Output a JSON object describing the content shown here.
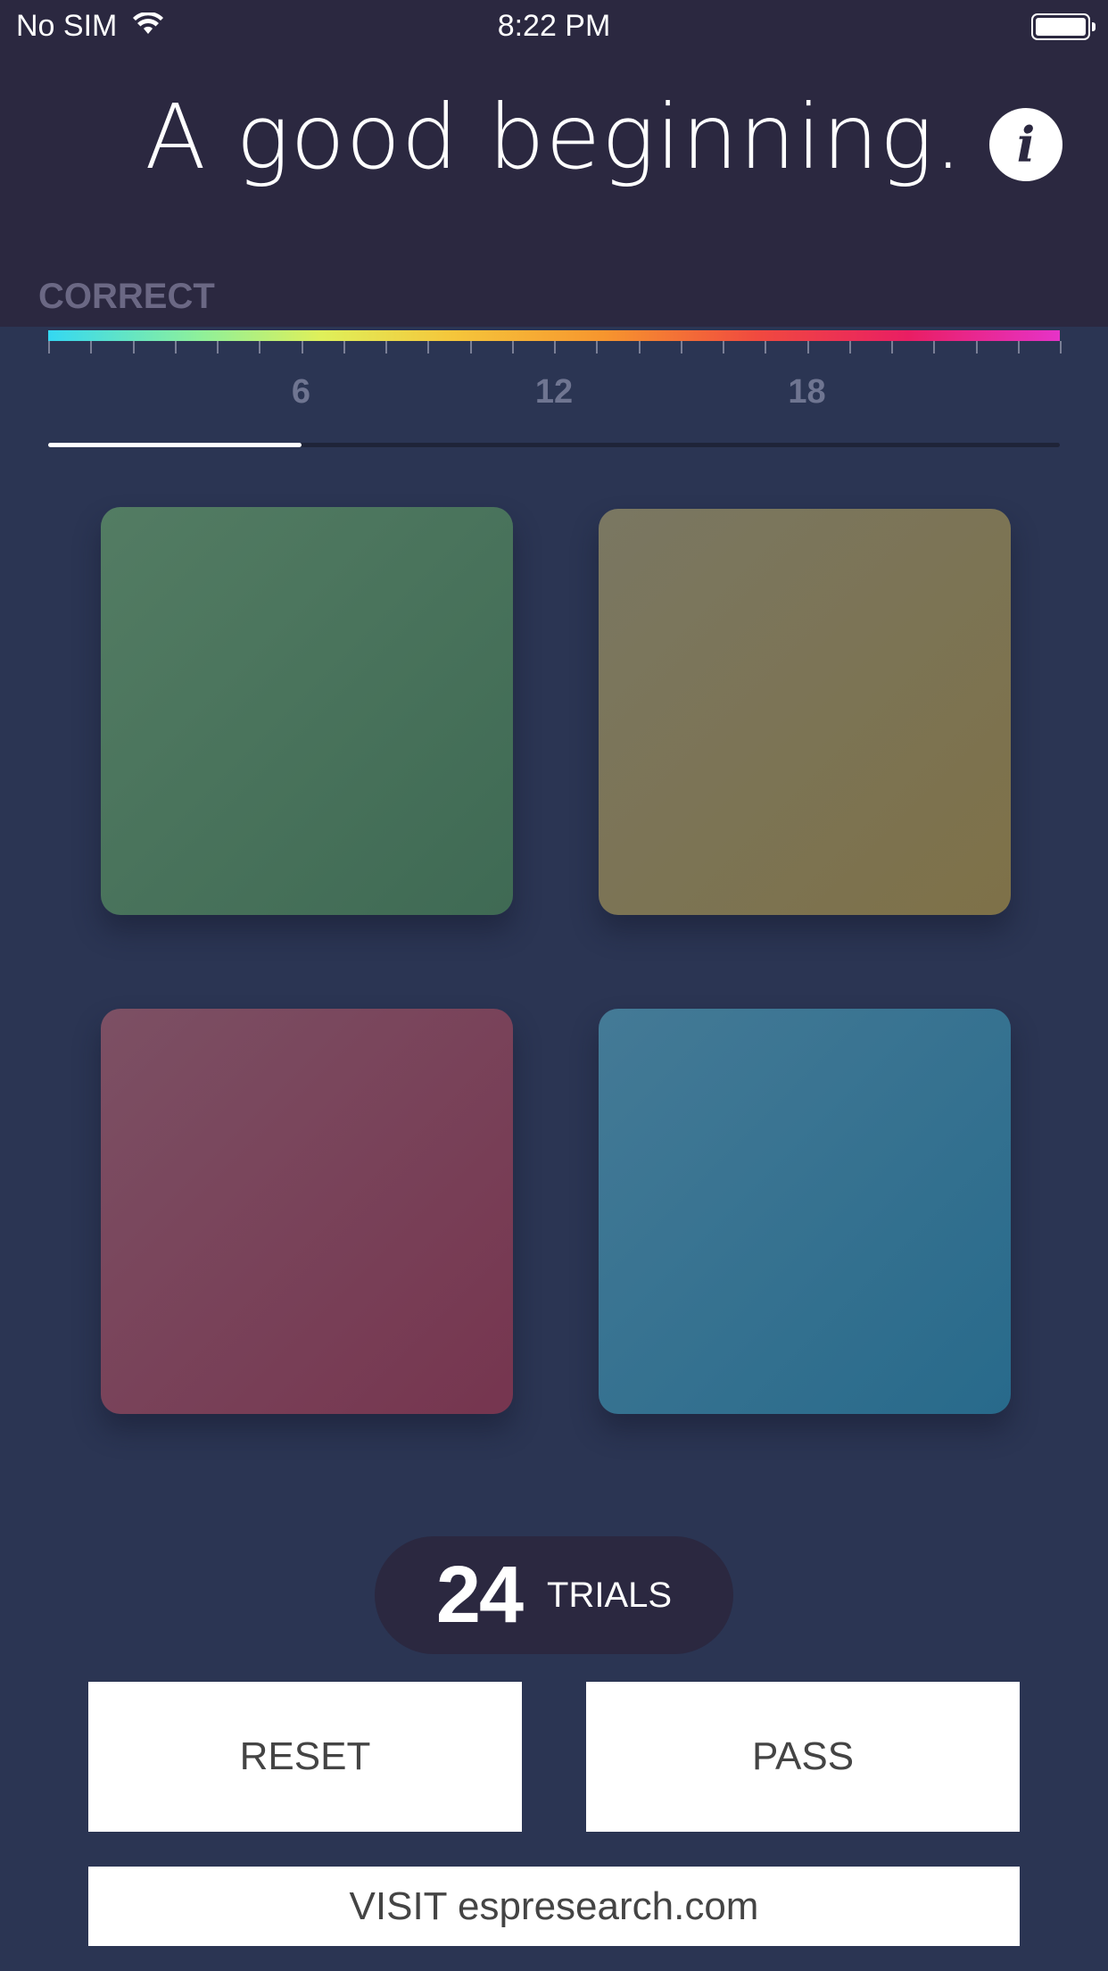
{
  "status_bar": {
    "carrier": "No SIM",
    "time": "8:22 PM",
    "wifi_icon": "wifi-icon",
    "battery_icon": "battery-icon"
  },
  "header": {
    "title": "A good beginning.",
    "info_icon_glyph": "i",
    "correct_label": "CORRECT"
  },
  "scale": {
    "gradient_colors": [
      "#34d8f2",
      "#8ef09a",
      "#dff05a",
      "#f5c63b",
      "#f6952e",
      "#f04a3f",
      "#e91e63",
      "#e633c8"
    ],
    "tick_labels": [
      "6",
      "12",
      "18"
    ],
    "tick_count": 24,
    "progress_value": 6,
    "progress_max": 24
  },
  "tiles": {
    "colors": [
      "#4a7560",
      "#7d7455",
      "#79425a",
      "#377190"
    ]
  },
  "trials": {
    "count": "24",
    "label": "TRIALS"
  },
  "buttons": {
    "reset": "RESET",
    "pass": "PASS",
    "visit": "VISIT espresearch.com"
  }
}
